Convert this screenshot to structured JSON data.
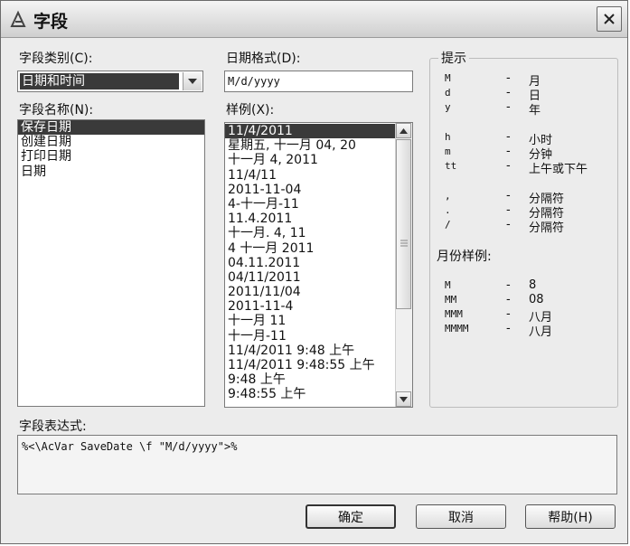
{
  "window": {
    "title": "字段"
  },
  "category": {
    "label": "字段类别(C):",
    "value": "日期和时间"
  },
  "names": {
    "label": "字段名称(N):",
    "items": [
      "保存日期",
      "创建日期",
      "打印日期",
      "日期"
    ]
  },
  "date_format": {
    "label": "日期格式(D):",
    "value": "M/d/yyyy"
  },
  "samples": {
    "label": "样例(X):",
    "items": [
      "11/4/2011",
      "星期五, 十一月 04, 20",
      "十一月 4, 2011",
      "11/4/11",
      "2011-11-04",
      "4-十一月-11",
      "11.4.2011",
      "十一月. 4, 11",
      "4 十一月 2011",
      "04.11.2011",
      "04/11/2011",
      "2011/11/04",
      "2011-11-4",
      "十一月 11",
      "十一月-11",
      "11/4/2011 9:48 上午",
      "11/4/2011 9:48:55 上午",
      "9:48 上午",
      "9:48:55 上午"
    ]
  },
  "hints": {
    "title": "提示",
    "rows": [
      {
        "key": "M",
        "dash": "-",
        "val": "月"
      },
      {
        "key": "d",
        "dash": "-",
        "val": "日"
      },
      {
        "key": "y",
        "dash": "-",
        "val": "年"
      },
      {
        "key": "h",
        "dash": "-",
        "val": "小时"
      },
      {
        "key": "m",
        "dash": "-",
        "val": "分钟"
      },
      {
        "key": "tt",
        "dash": "-",
        "val": "上午或下午"
      },
      {
        "key": ",",
        "dash": "-",
        "val": "分隔符"
      },
      {
        "key": ".",
        "dash": "-",
        "val": "分隔符"
      },
      {
        "key": "/",
        "dash": "-",
        "val": "分隔符"
      }
    ],
    "month_title": "月份样例:",
    "month_rows": [
      {
        "key": "M",
        "dash": "-",
        "val": "8"
      },
      {
        "key": "MM",
        "dash": "-",
        "val": "08"
      },
      {
        "key": "MMM",
        "dash": "-",
        "val": "八月"
      },
      {
        "key": "MMMM",
        "dash": "-",
        "val": "八月"
      }
    ]
  },
  "expression": {
    "label": "字段表达式:",
    "value": "%<\\AcVar SaveDate \\f \"M/d/yyyy\">%"
  },
  "buttons": {
    "ok": "确定",
    "cancel": "取消",
    "help": "帮助(H)"
  }
}
